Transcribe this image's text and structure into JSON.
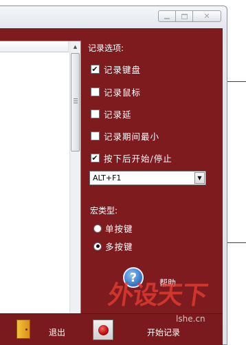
{
  "window": {
    "caption_buttons": [
      "minimize-icon",
      "maximize-icon",
      "close-icon"
    ]
  },
  "options": {
    "title": "记录选项:",
    "checkboxes": [
      {
        "label": "记录键盘",
        "checked": true
      },
      {
        "label": "记录鼠标",
        "checked": false
      },
      {
        "label": "记录延",
        "checked": false
      },
      {
        "label": "记录期间最小",
        "checked": false
      },
      {
        "label": "按下后开始/停止",
        "checked": true
      }
    ],
    "hotkey": {
      "value": "ALT+F1"
    }
  },
  "macro_type": {
    "title": "宏类型:",
    "radios": [
      {
        "label": "单按键",
        "selected": false
      },
      {
        "label": "多按键",
        "selected": true
      }
    ]
  },
  "help": {
    "label": "帮助",
    "icon": "help-icon",
    "icon_glyph": "?"
  },
  "toolbar": {
    "exit_label": "退出",
    "record_label": "开始记录"
  },
  "watermark": {
    "text": "外设天下",
    "url": "lshe.cn"
  },
  "colors": {
    "panel": "#7d1b1f",
    "text": "#ffffff"
  }
}
